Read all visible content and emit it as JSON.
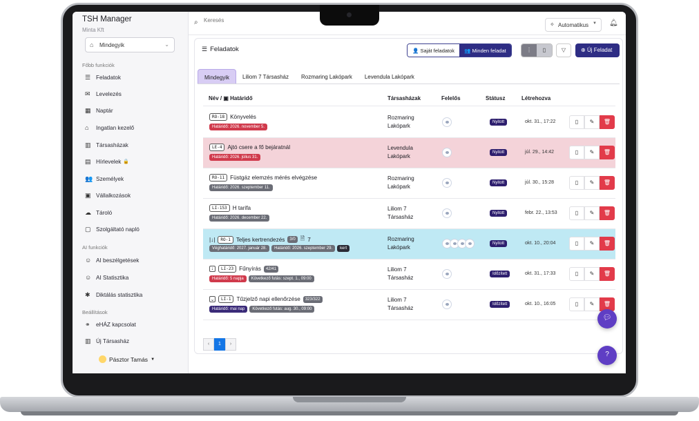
{
  "app": {
    "title": "TSH Manager",
    "subtitle": "Minta Kft"
  },
  "sidebar": {
    "filter_value": "Mindegyik",
    "sections": {
      "main": "Főbb funkciók",
      "ai": "AI funkciók",
      "settings": "Beállítások"
    },
    "items": [
      {
        "label": "Feladatok",
        "icon": "list-icon"
      },
      {
        "label": "Levelezés",
        "icon": "mail-icon"
      },
      {
        "label": "Naptár",
        "icon": "calendar-icon"
      },
      {
        "label": "Ingatlan kezelő",
        "icon": "home-icon"
      },
      {
        "label": "Társasházak",
        "icon": "building-icon"
      },
      {
        "label": "Hírlevelek",
        "icon": "newspaper-icon"
      },
      {
        "label": "Személyek",
        "icon": "people-icon"
      },
      {
        "label": "Vállalkozások",
        "icon": "briefcase-icon"
      },
      {
        "label": "Tároló",
        "icon": "cloud-icon"
      },
      {
        "label": "Szolgáltató napló",
        "icon": "clipboard-icon"
      }
    ],
    "ai_items": [
      {
        "label": "AI beszélgetések",
        "icon": "robot-icon"
      },
      {
        "label": "AI Statisztika",
        "icon": "chart-icon"
      },
      {
        "label": "Diktálás statisztika",
        "icon": "mic-icon"
      }
    ],
    "settings_items": [
      {
        "label": "eHÁZ kapcsolat",
        "icon": "link-icon"
      },
      {
        "label": "Új Társasház",
        "icon": "building-add-icon"
      }
    ],
    "user": "Pásztor Tamás"
  },
  "topbar": {
    "search_placeholder": "Keresés",
    "theme_label": "Automatikus"
  },
  "main": {
    "title": "Feladatok",
    "own_tasks": "Saját feladatok",
    "all_tasks": "Minden feladat",
    "new_task": "Új Feladat",
    "tabs": [
      "Mindegyik",
      "Liliom 7 Társasház",
      "Rozmaring Lakópark",
      "Levendula Lakópark"
    ],
    "columns": {
      "name": "Név / ▣ Határidő",
      "house": "Társasházak",
      "assignee": "Felelős",
      "status": "Státusz",
      "created": "Létrehozva"
    },
    "rows": [
      {
        "code": "RO-18",
        "title": "Könyvelés",
        "badges": [
          {
            "text": "Határidő: 2026. november 5.",
            "kind": "red"
          }
        ],
        "house_1": "Rozmaring",
        "house_2": "Lakópark",
        "status": "Nyitott",
        "created": "okt. 31., 17:22"
      },
      {
        "code": "LE-4",
        "title": "Ajtó csere a fő bejáratnál",
        "badges": [
          {
            "text": "Határidő: 2026. július 31.",
            "kind": "red"
          }
        ],
        "house_1": "Levendula",
        "house_2": "Lakópark",
        "status": "Nyitott",
        "created": "júl. 29., 14:42"
      },
      {
        "code": "RO-11",
        "title": "Füstgáz elemzés mérés elvégzése",
        "badges": [
          {
            "text": "Határidő: 2026. szeptember 11.",
            "kind": "gray"
          }
        ],
        "house_1": "Rozmaring",
        "house_2": "Lakópark",
        "status": "Nyitott",
        "created": "júl. 30., 15:28"
      },
      {
        "code": "LI-153",
        "title": "H tarifa",
        "badges": [
          {
            "text": "Határidő: 2026. december 22.",
            "kind": "gray"
          }
        ],
        "house_1": "Liliom 7",
        "house_2": "Társasház",
        "status": "Nyitott",
        "created": "febr. 22., 13:53"
      },
      {
        "code": "RO-1",
        "title": "Teljes kertrendezés",
        "count": "3/0",
        "extra": "7",
        "badges": [
          {
            "text": "Véghatáridő: 2027. január 28.",
            "kind": "gray"
          },
          {
            "text": "Határidő: 2026. szeptember 29.",
            "kind": "gray"
          },
          {
            "text": "kert",
            "kind": "dark"
          }
        ],
        "house_1": "Rozmaring",
        "house_2": "Lakópark",
        "status": "Nyitott",
        "created": "okt. 10., 20:04"
      },
      {
        "code": "LI-23",
        "title": "Fűnyírás",
        "count": "42/41",
        "badges": [
          {
            "text": "Határidő: 5 napja",
            "kind": "red"
          },
          {
            "text": "Következő futás: szept. 1., 09:00",
            "kind": "gray"
          }
        ],
        "house_1": "Liliom 7",
        "house_2": "Társasház",
        "status": "Időzített",
        "created": "okt. 31., 17:33"
      },
      {
        "code": "LI-1",
        "title": "Tűzjelző napi ellenőrzése",
        "count": "323/322",
        "badges": [
          {
            "text": "Határidő: mai nap",
            "kind": "purple"
          },
          {
            "text": "Következő futás: aug. 30., 09:00",
            "kind": "gray"
          }
        ],
        "house_1": "Liliom 7",
        "house_2": "Társasház",
        "status": "Időzített",
        "created": "okt. 10., 16:05"
      }
    ],
    "pager": {
      "prev": "‹",
      "page": "1",
      "next": "›"
    }
  }
}
